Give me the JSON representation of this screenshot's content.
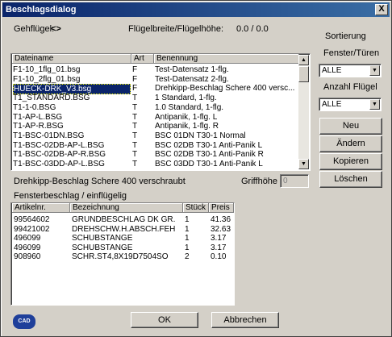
{
  "window": {
    "title": "Beschlagsdialog",
    "close_label": "X"
  },
  "header": {
    "gehfluegel_label": "Gehflügel:",
    "gehfluegel_value": "<>",
    "dimensions_label": "Flügelbreite/Flügelhöhe:",
    "dimensions_value": "0.0 / 0.0"
  },
  "file_list": {
    "columns": [
      "Dateiname",
      "Art",
      "Benennung"
    ],
    "rows": [
      [
        "F1-10_1flg_01.bsg",
        "F",
        "Test-Datensatz 1-flg."
      ],
      [
        "F1-10_2flg_01.bsg",
        "F",
        "Test-Datensatz 2-flg."
      ],
      [
        "HUECK-DRK_V3.bsg",
        "F",
        "Drehkipp-Beschlag  Schere 400   versc..."
      ],
      [
        "T1_STANDARD.BSG",
        "T",
        "1 Standard,   1-flg."
      ],
      [
        "T1-1-0.BSG",
        "T",
        "1.0 Standard,   1-flg."
      ],
      [
        "T1-AP-L.BSG",
        "T",
        "Antipanik,      1-flg.  L"
      ],
      [
        "T1-AP-R.BSG",
        "T",
        "Antipanik,      1-flg.  R"
      ],
      [
        "T1-BSC-01DN.BSG",
        "T",
        "BSC 01DN   T30-1  Normal"
      ],
      [
        "T1-BSC-02DB-AP-L.BSG",
        "T",
        "BSC 02DB   T30-1  Anti-Panik  L"
      ],
      [
        "T1-BSC-02DB-AP-R.BSG",
        "T",
        "BSC 02DB   T30-1  Anti-Panik  R"
      ],
      [
        "T1-BSC-03DD-AP-L.BSG",
        "T",
        "BSC 03DD   T30-1  Anti-Panik  L"
      ]
    ]
  },
  "selection": {
    "description": "Drehkipp-Beschlag  Schere 400   verschraubt",
    "grifhoehe_label": "Griffhöhe",
    "grifhoehe_value": "0",
    "subtitle": "Fensterbeschlag / einflügelig"
  },
  "articles": {
    "columns": [
      "Artikelnr.",
      "Bezeichnung",
      "Stück",
      "Preis"
    ],
    "rows": [
      [
        "99564602",
        "GRUNDBESCHLAG DK GR.",
        "1",
        "41.36"
      ],
      [
        "99421002",
        "DREHSCHW.H.ABSCH.FEH",
        "1",
        "32.63"
      ],
      [
        "496099",
        "SCHUBSTANGE",
        "1",
        "3.17"
      ],
      [
        "496099",
        "SCHUBSTANGE",
        "1",
        "3.17"
      ],
      [
        "908960",
        "SCHR.ST4,8X19D7504SO",
        "2",
        "0.10"
      ]
    ]
  },
  "sidebar": {
    "sort_label": "Sortierung",
    "fenster_label": "Fenster/Türen",
    "fenster_value": "ALLE",
    "anzahl_label": "Anzahl Flügel",
    "anzahl_value": "ALLE",
    "buttons": [
      "Neu",
      "Ändern",
      "Kopieren",
      "Löschen"
    ]
  },
  "footer": {
    "ok_label": "OK",
    "cancel_label": "Abbrechen",
    "logo_text": "CAD"
  },
  "colors": {
    "selection": "#0a246a",
    "title_start": "#0a246a",
    "title_end": "#3a6ea5"
  }
}
